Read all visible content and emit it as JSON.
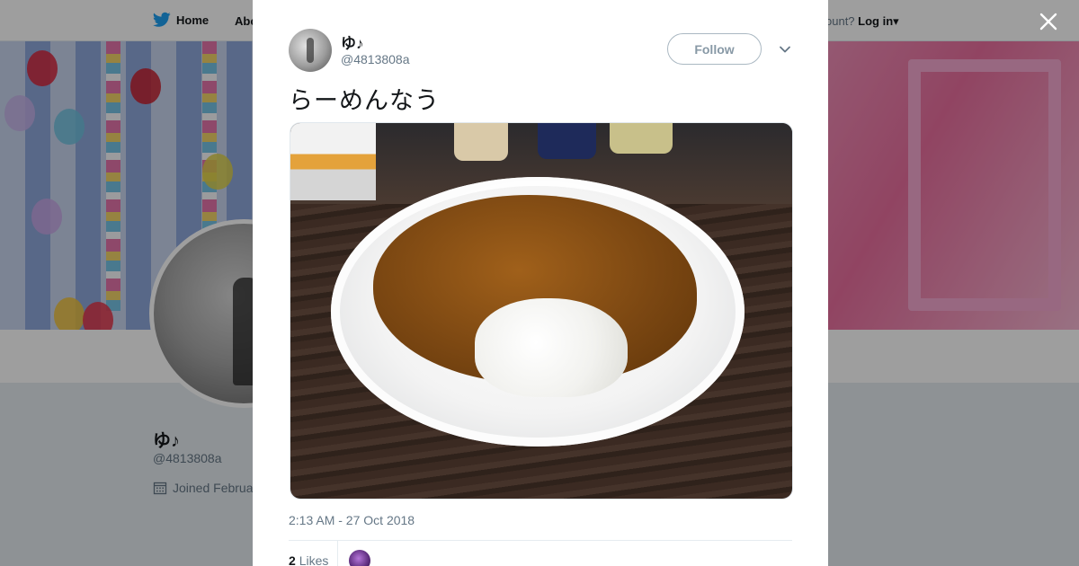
{
  "nav": {
    "home_label": "Home",
    "about_label": "Abo",
    "account_prompt": "ccount?",
    "login_label": "Log in"
  },
  "profile": {
    "name": "ゆ♪",
    "handle": "@4813808a",
    "joined": "Joined Februa"
  },
  "tweet": {
    "author_name": "ゆ♪",
    "author_handle": "@4813808a",
    "follow_label": "Follow",
    "text": "らーめんなう",
    "timestamp": "2:13 AM - 27 Oct 2018",
    "likes_count": "2",
    "likes_label": "Likes"
  },
  "colors": {
    "brand_blue": "#1da1f2",
    "text_primary": "#14171a",
    "text_secondary": "#657786"
  }
}
